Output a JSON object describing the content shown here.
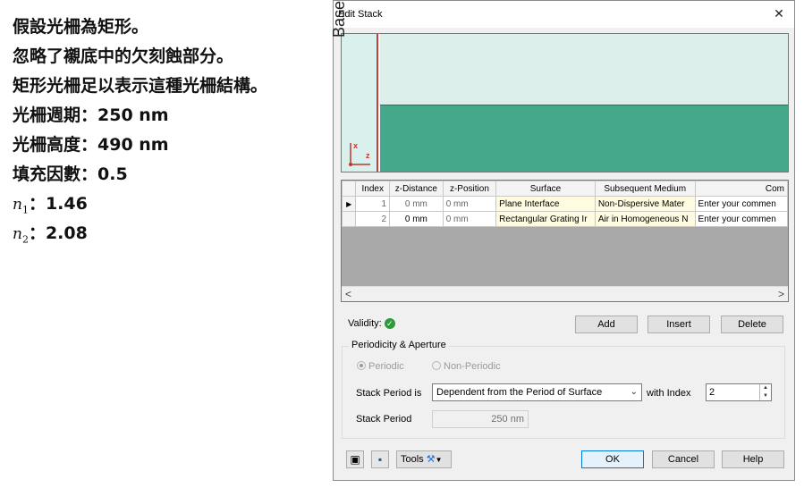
{
  "notes": {
    "lines": [
      "假設光柵為矩形。",
      "忽略了襯底中的欠刻蝕部分。",
      "矩形光柵足以表示這種光柵結構。",
      "光柵週期：250 nm",
      "光柵高度：490 nm",
      "填充因數：0.5"
    ],
    "n1_sym": "n",
    "n1_sub": "1",
    "n1_val": "：1.46",
    "n2_sym": "n",
    "n2_sub": "2",
    "n2_val": "：2.08"
  },
  "dialog": {
    "title": "Edit Stack",
    "close_glyph": "✕",
    "preview": {
      "block_label": "Base Block",
      "axis_x": "x",
      "axis_z": "z"
    },
    "table": {
      "columns": [
        "Index",
        "z-Distance",
        "z-Position",
        "Surface",
        "Subsequent Medium",
        "Com"
      ],
      "rows": [
        {
          "marker": "▶",
          "index": "1",
          "z_distance": "0 mm",
          "z_position": "0 mm",
          "surface": "Plane Interface",
          "medium": "Non-Dispersive Mater",
          "comment": "Enter your commen"
        },
        {
          "marker": "",
          "index": "2",
          "z_distance": "0 mm",
          "z_position": "0 mm",
          "surface": "Rectangular Grating Ir",
          "medium": "Air in Homogeneous N",
          "comment": "Enter your commen"
        }
      ],
      "scroll_left": "<",
      "scroll_right": ">"
    },
    "validity_label": "Validity:",
    "buttons": {
      "add": "Add",
      "insert": "Insert",
      "delete": "Delete",
      "ok": "OK",
      "cancel": "Cancel",
      "help": "Help",
      "tools": "Tools"
    },
    "group": {
      "legend": "Periodicity & Aperture",
      "radio_periodic": "Periodic",
      "radio_nonperiodic": "Non-Periodic",
      "stack_period_is_label": "Stack Period is",
      "stack_period_mode": "Dependent from the Period of Surface",
      "with_index_label": "with Index",
      "index_value": "2",
      "stack_period_label": "Stack Period",
      "stack_period_value": "250 nm"
    }
  }
}
